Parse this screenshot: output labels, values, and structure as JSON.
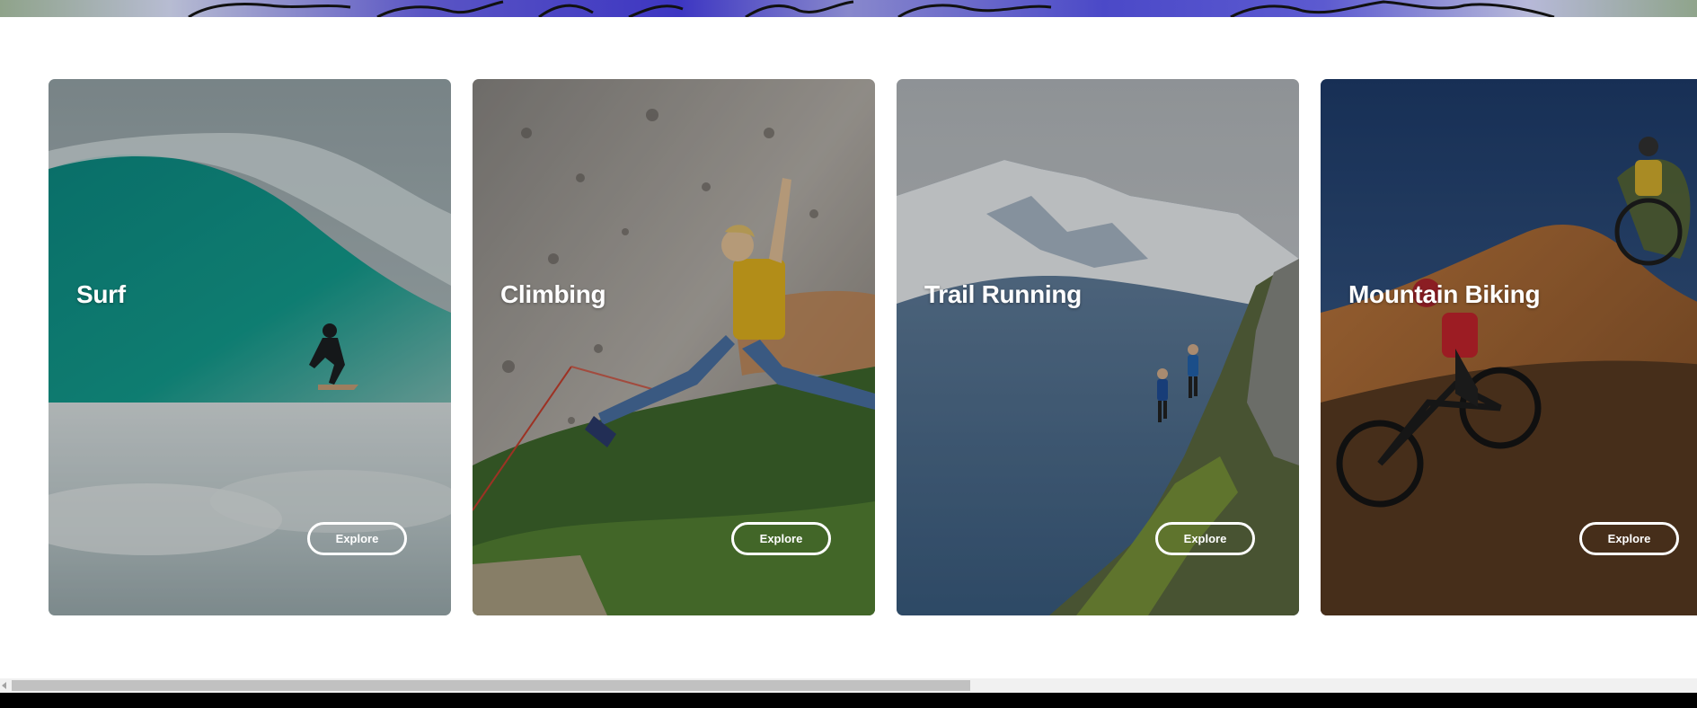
{
  "cards": [
    {
      "title": "Surf",
      "button": "Explore"
    },
    {
      "title": "Climbing",
      "button": "Explore"
    },
    {
      "title": "Trail Running",
      "button": "Explore"
    },
    {
      "title": "Mountain Biking",
      "button": "Explore"
    }
  ],
  "colors": {
    "card_text": "#ffffff",
    "scrollbar_track": "#f1f1f1",
    "scrollbar_thumb": "#c1c1c1"
  },
  "scroll": {
    "horizontal_position_fraction": 0.0
  }
}
